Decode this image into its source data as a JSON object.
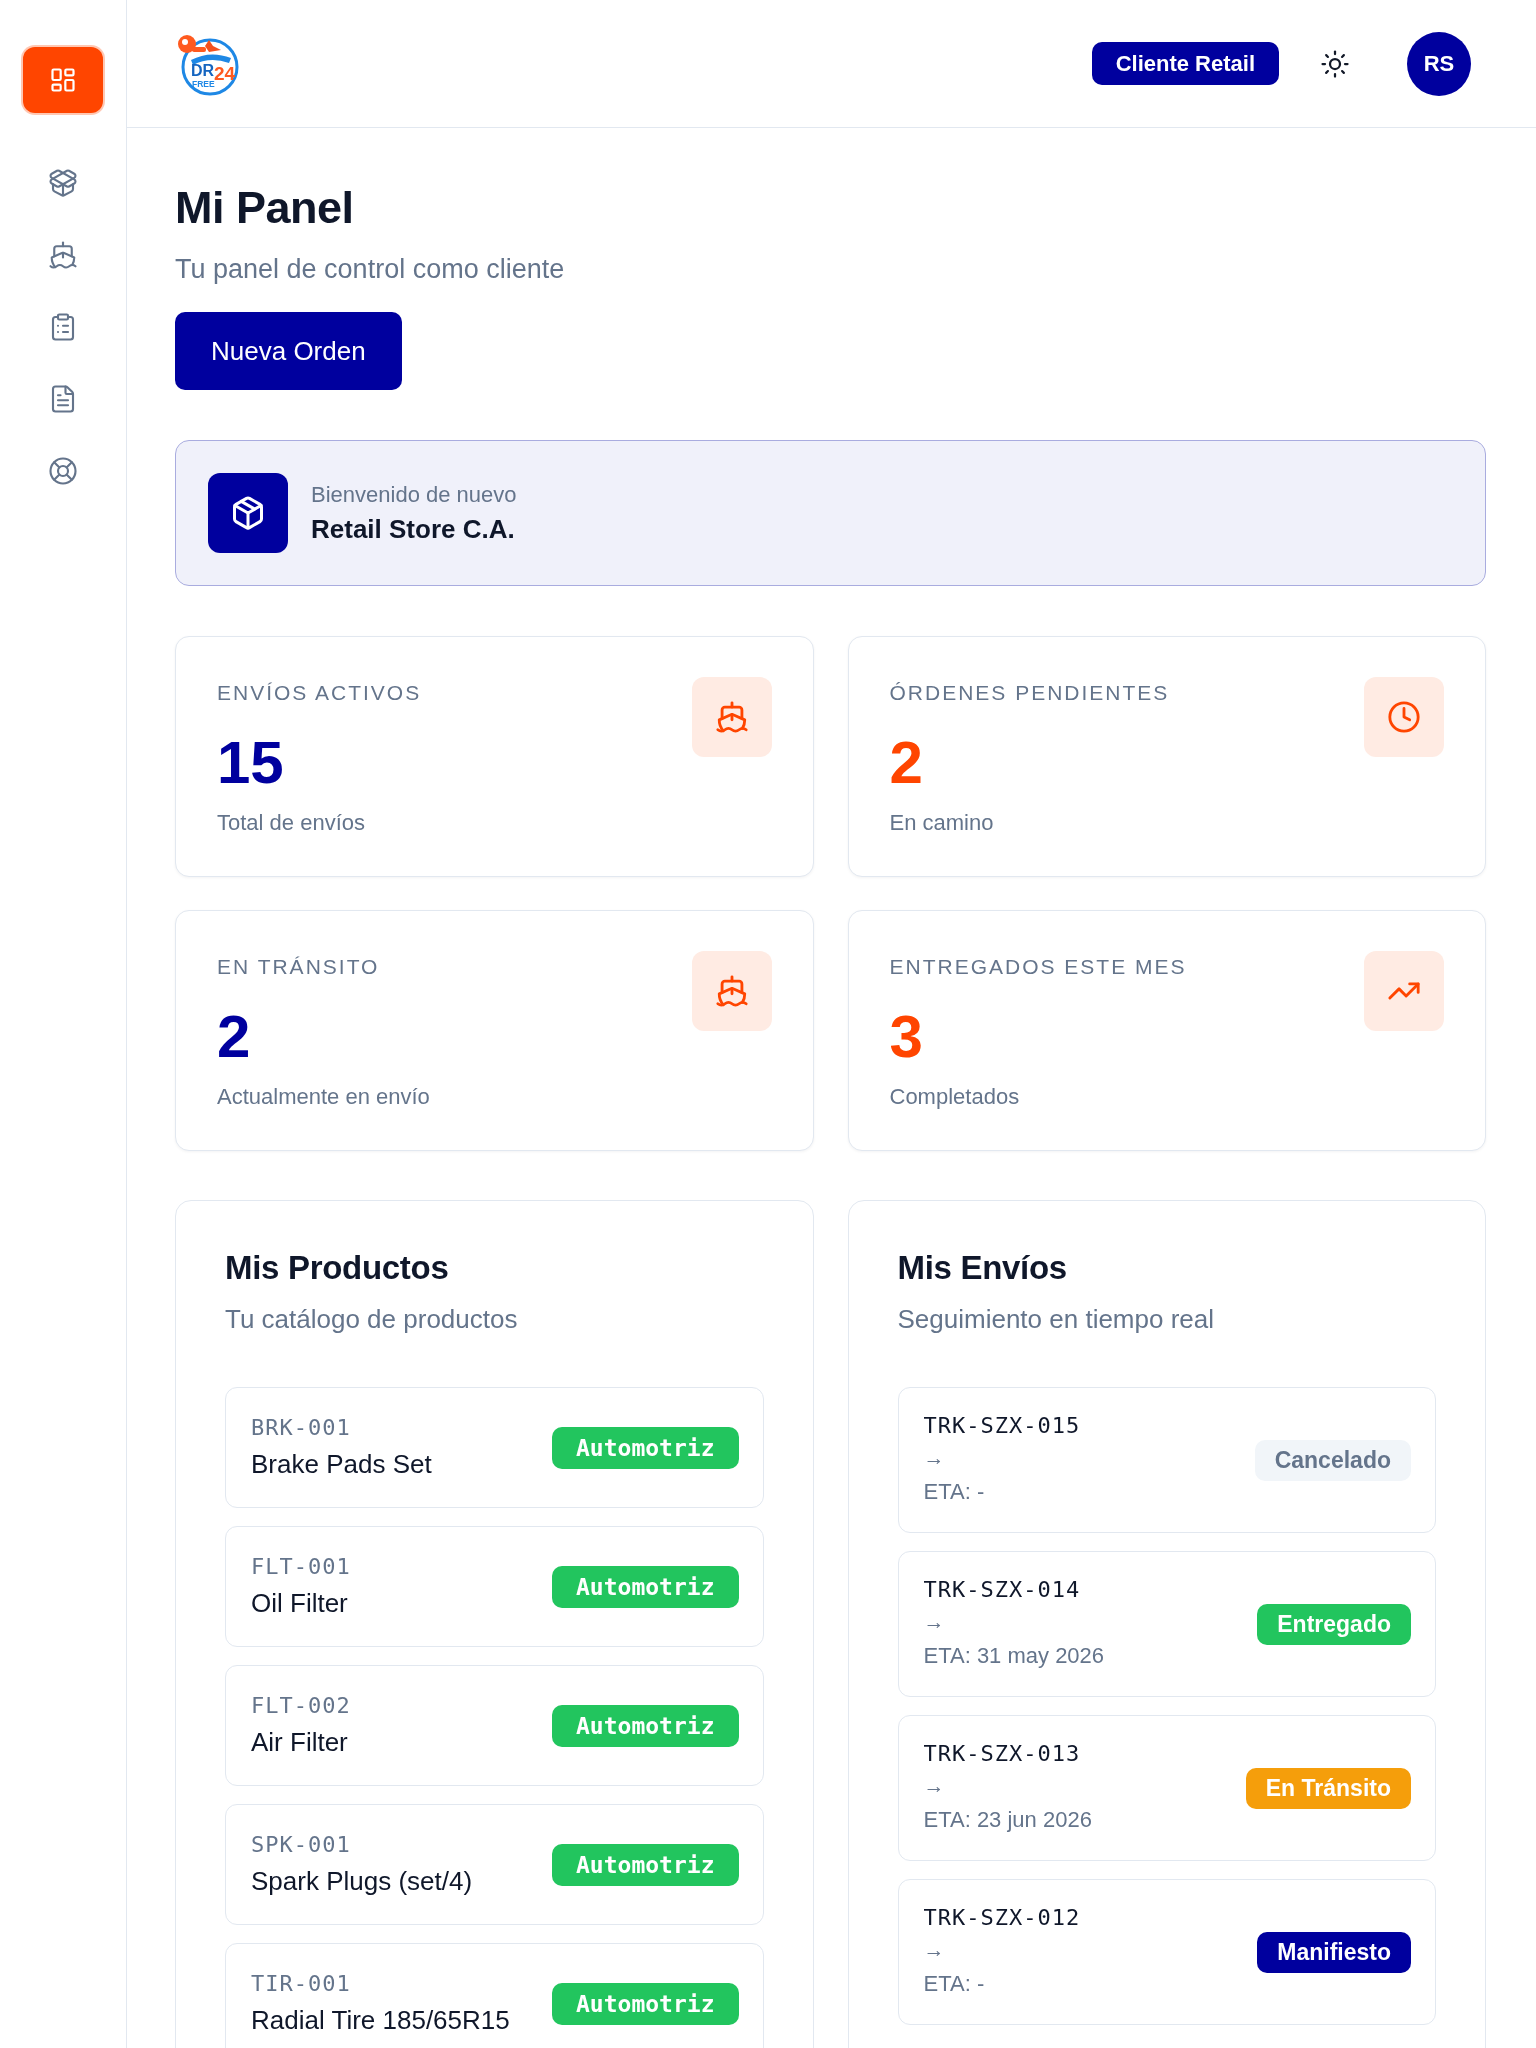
{
  "logo": {
    "lines": [
      "DR",
      "FREE",
      "24"
    ]
  },
  "sidebar": {
    "items": [
      {
        "selected": true
      },
      {
        "selected": false
      },
      {
        "selected": false
      },
      {
        "selected": false
      },
      {
        "selected": false
      },
      {
        "selected": false
      }
    ]
  },
  "header": {
    "role_badge": "Cliente Retail",
    "avatar": "RS"
  },
  "page": {
    "title": "Mi Panel",
    "subtitle": "Tu panel de control como cliente",
    "primary_button": "Nueva Orden"
  },
  "welcome": {
    "greeting": "Bienvenido de nuevo",
    "name": "Retail Store C.A."
  },
  "stats": [
    {
      "label": "ENVÍOS ACTIVOS",
      "value": "15",
      "caption": "Total de envíos",
      "color": "#00009e"
    },
    {
      "label": "ÓRDENES PENDIENTES",
      "value": "2",
      "caption": "En camino",
      "color": "#ff4500"
    },
    {
      "label": "EN TRÁNSITO",
      "value": "2",
      "caption": "Actualmente en envío",
      "color": "#00009e"
    },
    {
      "label": "ENTREGADOS ESTE MES",
      "value": "3",
      "caption": "Completados",
      "color": "#ff4500"
    }
  ],
  "products": {
    "title": "Mis Productos",
    "subtitle": "Tu catálogo de productos",
    "items": [
      {
        "code": "BRK-001",
        "name": "Brake Pads Set",
        "category": "Automotriz"
      },
      {
        "code": "FLT-001",
        "name": "Oil Filter",
        "category": "Automotriz"
      },
      {
        "code": "FLT-002",
        "name": "Air Filter",
        "category": "Automotriz"
      },
      {
        "code": "SPK-001",
        "name": "Spark Plugs (set/4)",
        "category": "Automotriz"
      },
      {
        "code": "TIR-001",
        "name": "Radial Tire 185/65R15",
        "category": "Automotriz"
      }
    ]
  },
  "shipments": {
    "title": "Mis Envíos",
    "subtitle": "Seguimiento en tiempo real",
    "items": [
      {
        "tracking": "TRK-SZX-015",
        "route": "→",
        "eta": "ETA: -",
        "status": "Cancelado",
        "color": "#f1f5f9"
      },
      {
        "tracking": "TRK-SZX-014",
        "route": "→",
        "eta": "ETA: 31 may 2026",
        "status": "Entregado",
        "color": "#22c55e"
      },
      {
        "tracking": "TRK-SZX-013",
        "route": "→",
        "eta": "ETA: 23 jun 2026",
        "status": "En Tránsito",
        "color": "#f59e0b"
      },
      {
        "tracking": "TRK-SZX-012",
        "route": "→",
        "eta": "ETA: -",
        "status": "Manifiesto",
        "color": "#00009e"
      }
    ]
  }
}
